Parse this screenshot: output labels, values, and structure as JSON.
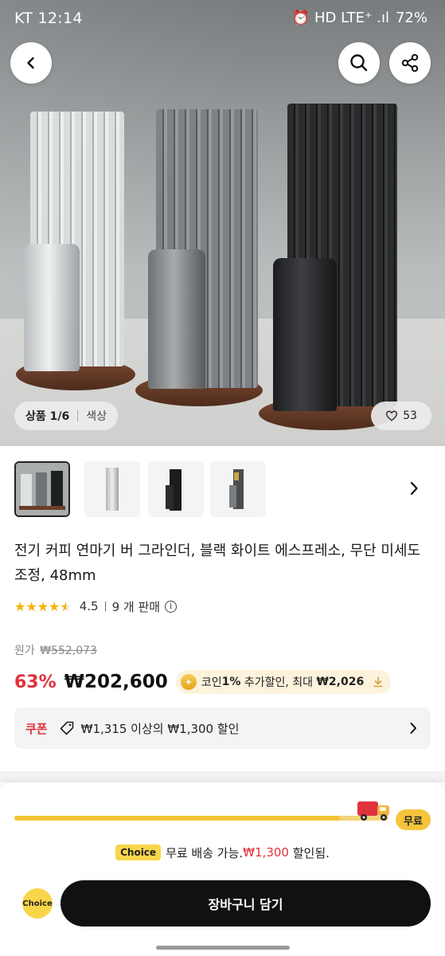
{
  "status_bar": {
    "carrier_time": "KT 12:14",
    "icons": "⏰ HD LTE⁺ .ıl",
    "battery": "72%"
  },
  "hero": {
    "image_counter": "상품 1/6",
    "image_label": "색상",
    "like_count": "53"
  },
  "product": {
    "title": "전기 커피 연마기 버 그라인더, 블랙 화이트 에스프레소, 무단 미세도 조정, 48mm",
    "rating_stars": "★★★★★",
    "rating_value": "4.5",
    "rating_fraction": 0.9,
    "sold": "9 개 판매",
    "info_glyph": "i"
  },
  "price": {
    "original_label": "원가",
    "original_value": "₩552,073",
    "discount": "63%",
    "current": "₩202,600",
    "coin_prefix": "코인 ",
    "coin_pct": "1%",
    "coin_mid": " 추가할인, 최대 ",
    "coin_max": "₩2,026"
  },
  "coupon": {
    "label": "쿠폰",
    "text": "₩1,315 이상의 ₩1,300 할인"
  },
  "shipping": {
    "progress": 0.87,
    "free_badge": "무료",
    "choice_tag": "Choice",
    "text_before": "무료 배송 가능.",
    "text_red": "₩1,300",
    "text_after": " 할인됨."
  },
  "bottom": {
    "choice": "Choice",
    "cart_button": "장바구니 담기"
  },
  "colors": {
    "accent_red": "#e0323c",
    "choice_yellow": "#f9d54a",
    "button_black": "#111111"
  }
}
